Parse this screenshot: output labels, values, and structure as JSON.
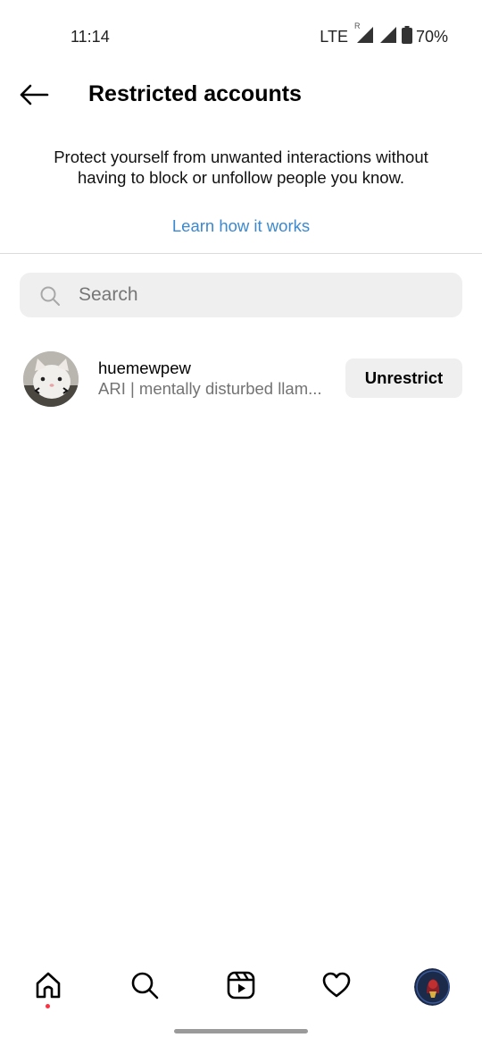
{
  "status_bar": {
    "time": "11:14",
    "network": "LTE",
    "roaming": "R",
    "battery": "70%"
  },
  "header": {
    "title": "Restricted accounts"
  },
  "intro": {
    "description": "Protect yourself from unwanted interactions without having to block or unfollow people you know.",
    "learn_link": "Learn how it works"
  },
  "search": {
    "placeholder": "Search",
    "value": ""
  },
  "accounts": [
    {
      "username": "huemewpew",
      "bio": "ARI | mentally disturbed llam...",
      "action_label": "Unrestrict"
    }
  ],
  "bottom_nav": {
    "items": [
      {
        "icon": "home-icon",
        "active": true
      },
      {
        "icon": "search-icon"
      },
      {
        "icon": "reels-icon"
      },
      {
        "icon": "heart-icon"
      },
      {
        "icon": "profile-avatar"
      }
    ],
    "notification_dot_color": "#ff3040"
  },
  "colors": {
    "link": "#3b89d0",
    "button_bg": "#efefef",
    "secondary_text": "#737373"
  }
}
